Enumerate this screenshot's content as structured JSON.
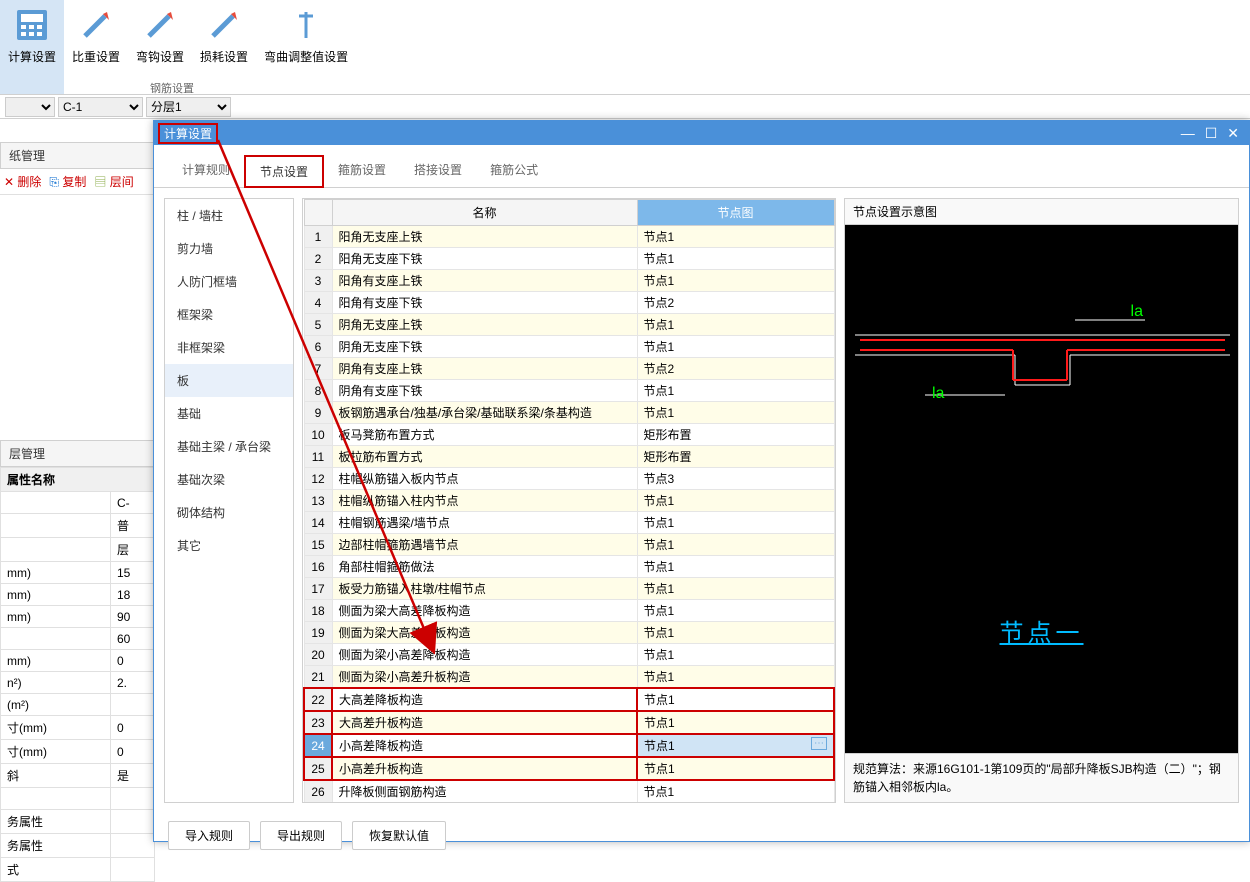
{
  "ribbon": {
    "items": [
      {
        "label": "计算设置"
      },
      {
        "label": "比重设置"
      },
      {
        "label": "弯钩设置"
      },
      {
        "label": "损耗设置"
      },
      {
        "label": "弯曲调整值设置"
      }
    ],
    "group_label": "钢筋设置"
  },
  "toolbar2": {
    "sel1": "",
    "sel2": "C-1",
    "sel3": "分层1"
  },
  "left": {
    "panel1_title": "纸管理",
    "btn_delete": "删除",
    "btn_copy": "复制",
    "btn_layer": "层间",
    "panel2_title": "层管理",
    "prop_header": "属性名称",
    "props": [
      {
        "k": "",
        "v": "C-"
      },
      {
        "k": "",
        "v": "普"
      },
      {
        "k": "",
        "v": "层"
      },
      {
        "k": "mm)",
        "v": "15"
      },
      {
        "k": "mm)",
        "v": "18"
      },
      {
        "k": "mm)",
        "v": "90"
      },
      {
        "k": "",
        "v": "60"
      },
      {
        "k": "mm)",
        "v": "0"
      },
      {
        "k": "n²)",
        "v": "2."
      },
      {
        "k": "(m²)",
        "v": ""
      },
      {
        "k": "寸(mm)",
        "v": "0"
      },
      {
        "k": "寸(mm)",
        "v": "0"
      },
      {
        "k": "斜",
        "v": "是"
      },
      {
        "k": "",
        "v": ""
      },
      {
        "k": "务属性",
        "v": ""
      },
      {
        "k": "务属性",
        "v": ""
      },
      {
        "k": "式",
        "v": ""
      }
    ]
  },
  "dialog": {
    "title": "计算设置",
    "tabs": [
      "计算规则",
      "节点设置",
      "箍筋设置",
      "搭接设置",
      "箍筋公式"
    ],
    "categories": [
      "柱 / 墙柱",
      "剪力墙",
      "人防门框墙",
      "框架梁",
      "非框架梁",
      "板",
      "基础",
      "基础主梁 / 承台梁",
      "基础次梁",
      "砌体结构",
      "其它"
    ],
    "selected_cat": "板",
    "col_name": "名称",
    "col_node": "节点图",
    "rows": [
      {
        "n": 1,
        "name": "阳角无支座上铁",
        "val": "节点1"
      },
      {
        "n": 2,
        "name": "阳角无支座下铁",
        "val": "节点1"
      },
      {
        "n": 3,
        "name": "阳角有支座上铁",
        "val": "节点1"
      },
      {
        "n": 4,
        "name": "阳角有支座下铁",
        "val": "节点2"
      },
      {
        "n": 5,
        "name": "阴角无支座上铁",
        "val": "节点1"
      },
      {
        "n": 6,
        "name": "阴角无支座下铁",
        "val": "节点1"
      },
      {
        "n": 7,
        "name": "阴角有支座上铁",
        "val": "节点2"
      },
      {
        "n": 8,
        "name": "阴角有支座下铁",
        "val": "节点1"
      },
      {
        "n": 9,
        "name": "板钢筋遇承台/独基/承台梁/基础联系梁/条基构造",
        "val": "节点1"
      },
      {
        "n": 10,
        "name": "板马凳筋布置方式",
        "val": "矩形布置"
      },
      {
        "n": 11,
        "name": "板拉筋布置方式",
        "val": "矩形布置"
      },
      {
        "n": 12,
        "name": "柱帽纵筋锚入板内节点",
        "val": "节点3"
      },
      {
        "n": 13,
        "name": "柱帽纵筋锚入柱内节点",
        "val": "节点1"
      },
      {
        "n": 14,
        "name": "柱帽钢筋遇梁/墙节点",
        "val": "节点1"
      },
      {
        "n": 15,
        "name": "边部柱帽箍筋遇墙节点",
        "val": "节点1"
      },
      {
        "n": 16,
        "name": "角部柱帽箍筋做法",
        "val": "节点1"
      },
      {
        "n": 17,
        "name": "板受力筋锚入柱墩/柱帽节点",
        "val": "节点1"
      },
      {
        "n": 18,
        "name": "侧面为梁大高差降板构造",
        "val": "节点1"
      },
      {
        "n": 19,
        "name": "侧面为梁大高差升板构造",
        "val": "节点1"
      },
      {
        "n": 20,
        "name": "侧面为梁小高差降板构造",
        "val": "节点1"
      },
      {
        "n": 21,
        "name": "侧面为梁小高差升板构造",
        "val": "节点1"
      },
      {
        "n": 22,
        "name": "大高差降板构造",
        "val": "节点1"
      },
      {
        "n": 23,
        "name": "大高差升板构造",
        "val": "节点1"
      },
      {
        "n": 24,
        "name": "小高差降板构造",
        "val": "节点1"
      },
      {
        "n": 25,
        "name": "小高差升板构造",
        "val": "节点1"
      },
      {
        "n": 26,
        "name": "升降板侧面钢筋构造",
        "val": "节点1"
      }
    ],
    "selected_row": 24,
    "preview_title": "节点设置示意图",
    "preview_label": "节点一",
    "preview_la": "la",
    "preview_desc": "规范算法：来源16G101-1第109页的\"局部升降板SJB构造（二）\"；钢筋锚入相邻板内la。",
    "btn_import": "导入规则",
    "btn_export": "导出规则",
    "btn_reset": "恢复默认值"
  }
}
